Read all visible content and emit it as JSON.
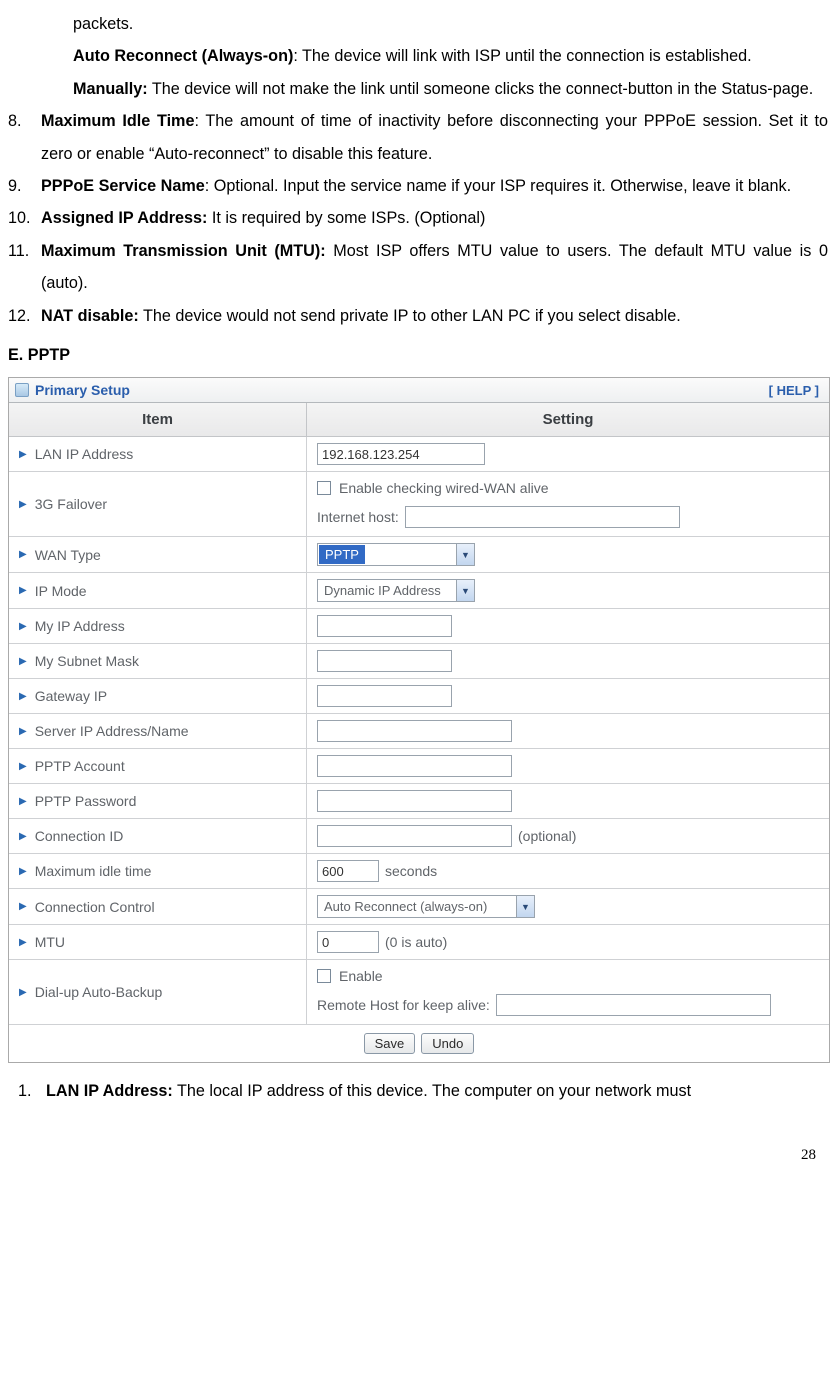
{
  "top": {
    "packets": "packets.",
    "auto_reconnect_label": "Auto Reconnect (Always-on)",
    "auto_reconnect_text": ": The device will link with ISP until the connection is established.",
    "manually_label": "Manually:",
    "manually_text": " The device will not make the link until someone clicks the connect-button in the Status-page."
  },
  "list": {
    "n8_num": "8.",
    "n8_label": "Maximum Idle Time",
    "n8_text": ": The amount of time of inactivity before disconnecting your PPPoE session. Set it to zero or enable “Auto-reconnect” to disable this feature.",
    "n9_num": "9.",
    "n9_label": "PPPoE Service Name",
    "n9_text": ": Optional. Input the service name if your ISP requires it. Otherwise, leave it blank.",
    "n10_num": "10.",
    "n10_label": "Assigned IP Address:",
    "n10_text": " It is required by some ISPs. (Optional)",
    "n11_num": "11.",
    "n11_label": "Maximum Transmission Unit (MTU):",
    "n11_text": " Most ISP offers MTU value to users. The default MTU value is 0 (auto).",
    "n12_num": "12.",
    "n12_label": "NAT disable:",
    "n12_text": " The device would not send private IP to other LAN PC if you select disable."
  },
  "section_e": "E. PPTP",
  "setup": {
    "title": "Primary Setup",
    "help": "[ HELP ]",
    "th_item": "Item",
    "th_setting": "Setting",
    "rows": {
      "lan_ip": {
        "label": "LAN IP Address",
        "value": "192.168.123.254"
      },
      "failover": {
        "label": "3G Failover",
        "chk_label": "Enable checking wired-WAN alive",
        "host_label": "Internet host:"
      },
      "wan_type": {
        "label": "WAN Type",
        "value": "PPTP"
      },
      "ip_mode": {
        "label": "IP Mode",
        "value": "Dynamic IP Address"
      },
      "my_ip": {
        "label": "My IP Address"
      },
      "my_subnet": {
        "label": "My Subnet Mask"
      },
      "gateway": {
        "label": "Gateway IP"
      },
      "server": {
        "label": "Server IP Address/Name"
      },
      "account": {
        "label": "PPTP Account"
      },
      "password": {
        "label": "PPTP Password"
      },
      "conn_id": {
        "label": "Connection ID",
        "hint": "(optional)"
      },
      "max_idle": {
        "label": "Maximum idle time",
        "value": "600",
        "unit": "seconds"
      },
      "conn_ctrl": {
        "label": "Connection Control",
        "value": "Auto Reconnect (always-on)"
      },
      "mtu": {
        "label": "MTU",
        "value": "0",
        "hint": "(0 is auto)"
      },
      "dialup": {
        "label": "Dial-up Auto-Backup",
        "chk_label": "Enable",
        "host_label": "Remote Host for keep alive:"
      }
    },
    "save": "Save",
    "undo": "Undo"
  },
  "bottom": {
    "n1_num": "1.",
    "n1_label": "LAN IP Address:",
    "n1_text": " The local IP address of this device. The computer on your network must"
  },
  "page_number": "28"
}
